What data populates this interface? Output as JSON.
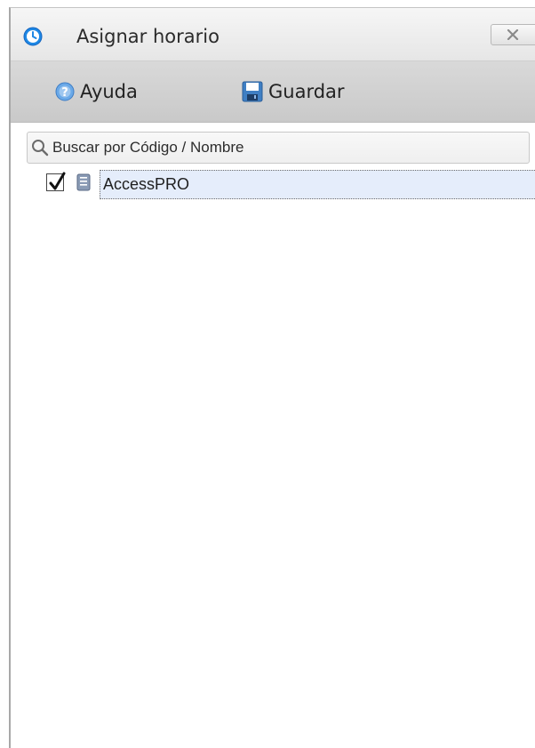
{
  "window": {
    "title": "Asignar horario",
    "title_icon": "clock-icon",
    "close_icon": "close-icon"
  },
  "toolbar": {
    "help_label": "Ayuda",
    "help_icon": "help-icon",
    "save_label": "Guardar",
    "save_icon": "floppy-disk-icon"
  },
  "search": {
    "placeholder": "Buscar por Código / Nombre",
    "value": "",
    "icon": "search-icon"
  },
  "tree": {
    "nodes": [
      {
        "label": "AccessPRO",
        "checked": true,
        "icon": "database-icon",
        "selected": true
      }
    ]
  },
  "colors": {
    "accent": "#1e88e5",
    "selection_bg": "#e5edfb",
    "toolbar_bg": "#d0d0d0"
  }
}
